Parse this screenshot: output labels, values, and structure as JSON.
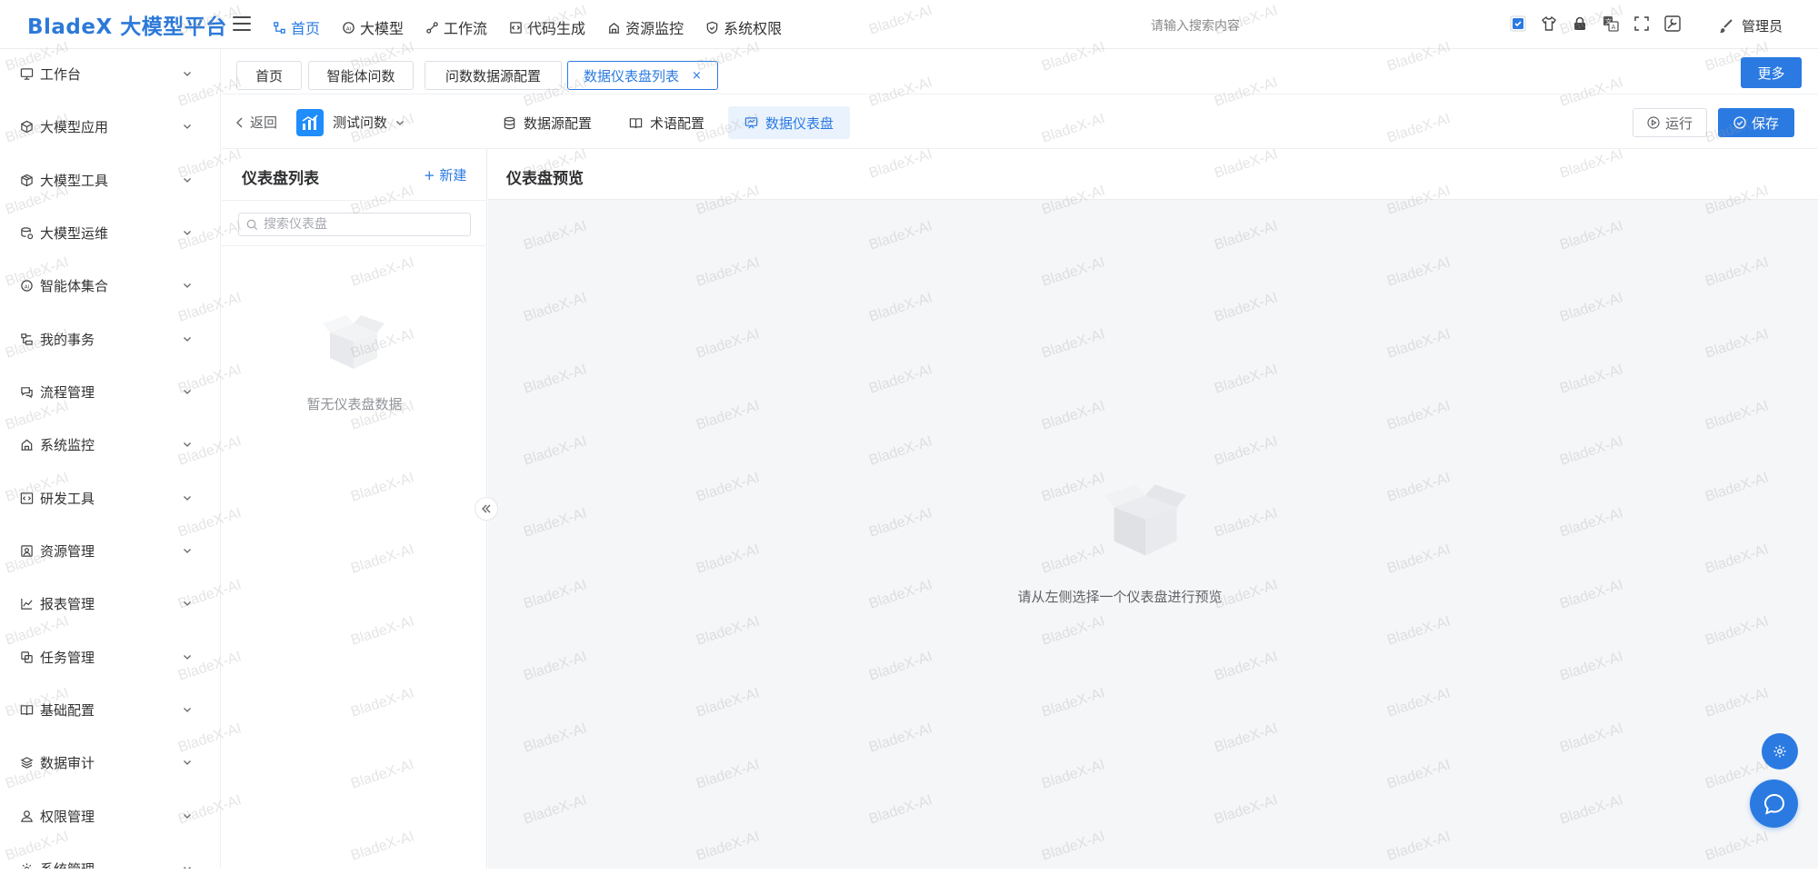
{
  "app": {
    "logo": "BladeX 大模型平台"
  },
  "topnav": [
    {
      "label": "首页",
      "icon": "home-tree-icon",
      "active": true
    },
    {
      "label": "大模型",
      "icon": "ai-model-icon",
      "active": false
    },
    {
      "label": "工作流",
      "icon": "workflow-icon",
      "active": false
    },
    {
      "label": "代码生成",
      "icon": "code-icon",
      "active": false
    },
    {
      "label": "资源监控",
      "icon": "monitor-icon",
      "active": false
    },
    {
      "label": "系统权限",
      "icon": "shield-icon",
      "active": false
    }
  ],
  "header": {
    "search_placeholder": "请输入搜索内容",
    "user_name": "管理员"
  },
  "sidebar": {
    "items": [
      {
        "label": "工作台"
      },
      {
        "label": "大模型应用"
      },
      {
        "label": "大模型工具"
      },
      {
        "label": "大模型运维"
      },
      {
        "label": "智能体集合"
      },
      {
        "label": "我的事务"
      },
      {
        "label": "流程管理"
      },
      {
        "label": "系统监控"
      },
      {
        "label": "研发工具"
      },
      {
        "label": "资源管理"
      },
      {
        "label": "报表管理"
      },
      {
        "label": "任务管理"
      },
      {
        "label": "基础配置"
      },
      {
        "label": "数据审计"
      },
      {
        "label": "权限管理"
      },
      {
        "label": "系统管理"
      }
    ]
  },
  "tabs": {
    "items": [
      {
        "label": "首页"
      },
      {
        "label": "智能体问数"
      },
      {
        "label": "问数数据源配置"
      },
      {
        "label": "数据仪表盘列表",
        "active": true,
        "close": "×"
      }
    ],
    "more_label": "更多"
  },
  "toolbar": {
    "back_label": "返回",
    "agent_name": "测试问数",
    "tabs": [
      {
        "label": "数据源配置"
      },
      {
        "label": "术语配置"
      },
      {
        "label": "数据仪表盘",
        "active": true
      }
    ],
    "run_label": "运行",
    "save_label": "保存"
  },
  "list_panel": {
    "title": "仪表盘列表",
    "new_label": "+ 新建",
    "search_placeholder": "搜索仪表盘",
    "empty_text": "暂无仪表盘数据"
  },
  "preview": {
    "title": "仪表盘预览",
    "empty_text": "请从左侧选择一个仪表盘进行预览"
  },
  "watermark_text": "BladeX-AI",
  "colors": {
    "primary": "#2a7ae2",
    "preview_bg": "#f5f6f8"
  }
}
